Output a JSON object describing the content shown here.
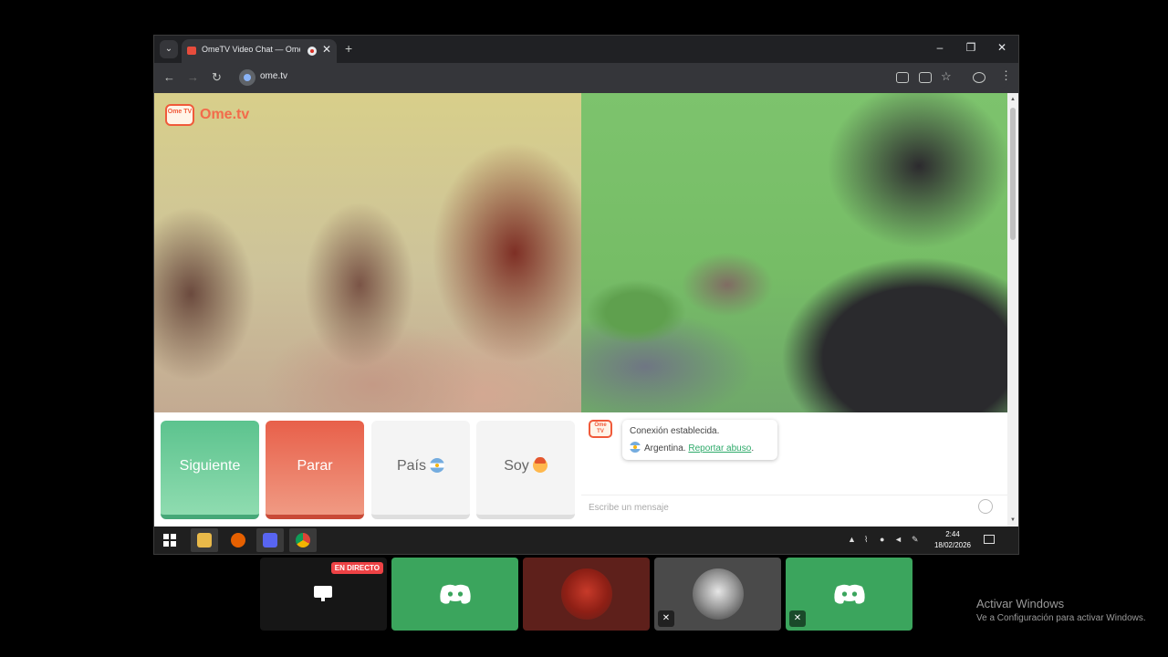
{
  "browser": {
    "tab_title": "OmeTV Video Chat — Ome",
    "tab_close": "✕",
    "new_tab": "+",
    "url": "ome.tv",
    "min": "–",
    "max": "❐",
    "close": "✕"
  },
  "site": {
    "logo_text": "Ome.tv",
    "logo_badge": "Ome TV"
  },
  "controls": {
    "next_label": "Siguiente",
    "stop_label": "Parar",
    "country_label": "País",
    "me_label": "Soy"
  },
  "chat": {
    "badge": "Ome TV",
    "msg1": "Conexión establecida.",
    "msg2_country": "Argentina.",
    "msg2_link": "Reportar abuso",
    "msg2_end": ".",
    "input_placeholder": "Escribe un mensaje"
  },
  "taskbar": {
    "time": "2:44",
    "date": "18/02/2026",
    "tray_arrow": "▲"
  },
  "discord": {
    "live_badge": "EN DIRECTO",
    "accent": "#3ba55d"
  },
  "watermark": {
    "title": "Activar Windows",
    "subtitle": "Ve a Configuración para activar Windows."
  }
}
